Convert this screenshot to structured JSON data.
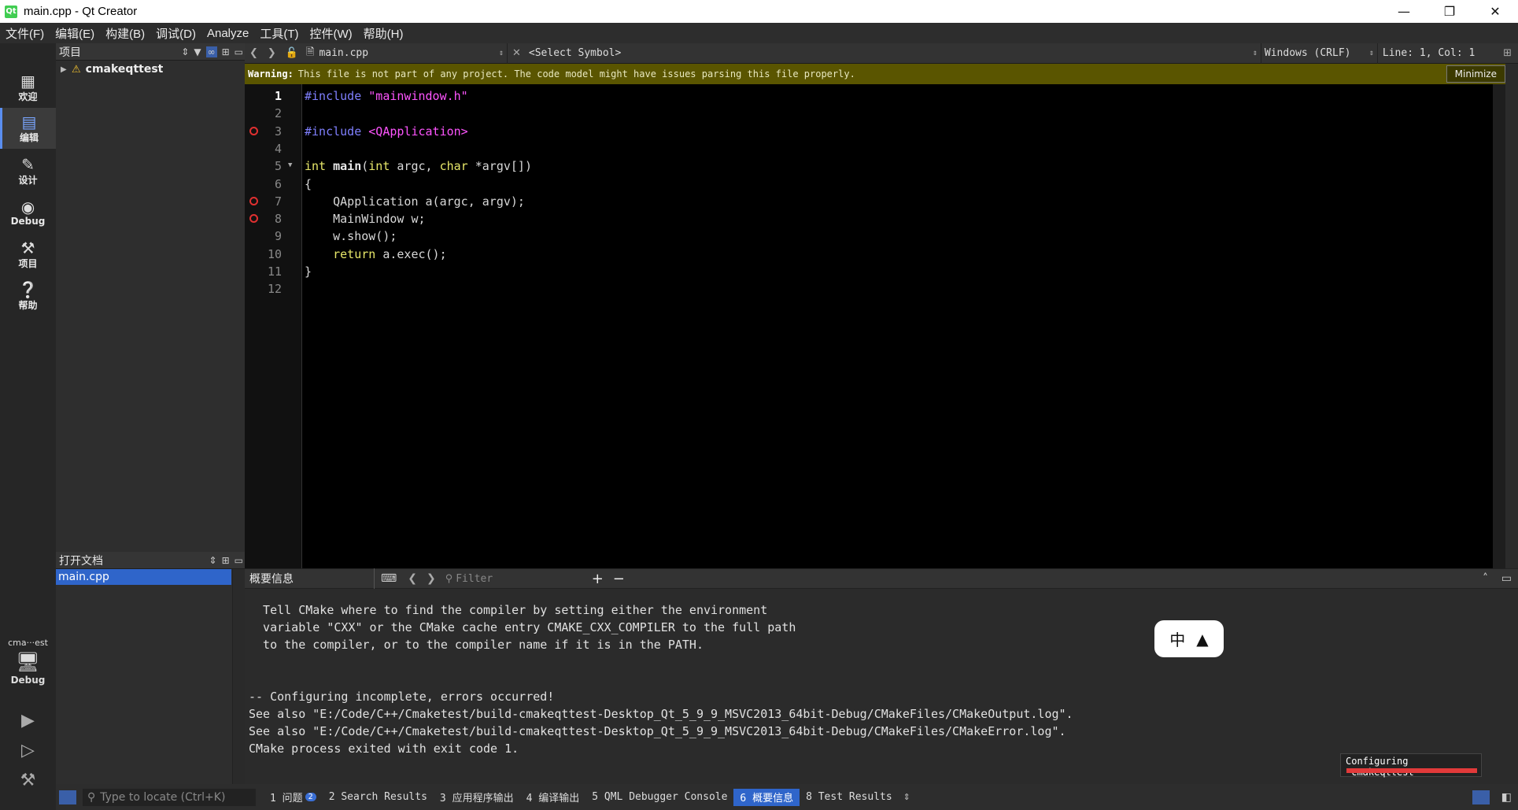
{
  "window": {
    "title": "main.cpp - Qt Creator",
    "app_icon": "Qt"
  },
  "menu": [
    "文件(F)",
    "编辑(E)",
    "构建(B)",
    "调试(D)",
    "Analyze",
    "工具(T)",
    "控件(W)",
    "帮助(H)"
  ],
  "modes": [
    {
      "label": "欢迎",
      "icon": "grid-icon"
    },
    {
      "label": "编辑",
      "icon": "edit-icon",
      "active": true
    },
    {
      "label": "设计",
      "icon": "pencil-icon"
    },
    {
      "label": "Debug",
      "icon": "bug-icon"
    },
    {
      "label": "项目",
      "icon": "wrench-icon"
    },
    {
      "label": "帮助",
      "icon": "help-icon"
    }
  ],
  "kit": {
    "project": "cma···est",
    "config": "Debug"
  },
  "projects_pane": {
    "title": "项目",
    "tree": [
      {
        "label": "cmakeqttest",
        "warning": true
      }
    ]
  },
  "open_docs": {
    "title": "打开文档",
    "files": [
      "main.cpp"
    ]
  },
  "editor_toolbar": {
    "file": "main.cpp",
    "symbol": "<Select Symbol>",
    "line_ending": "Windows (CRLF)",
    "position": "Line: 1, Col: 1"
  },
  "warning": {
    "label": "Warning:",
    "text": "This file is not part of any project. The code model might have issues parsing this file properly.",
    "button": "Minimize"
  },
  "code_lines": [
    {
      "n": "1",
      "html": "<span class=\"pp\">#include</span> <span class=\"str\">\"mainwindow.h\"</span>"
    },
    {
      "n": "2",
      "html": ""
    },
    {
      "n": "3",
      "html": "<span class=\"pp\">#include</span> <span class=\"str\">&lt;QApplication&gt;</span>",
      "bp": true
    },
    {
      "n": "4",
      "html": ""
    },
    {
      "n": "5",
      "html": "<span class=\"kw\">int</span> <span class=\"fn\">main</span>(<span class=\"kw\">int</span> argc, <span class=\"kw\">char</span> *argv[])",
      "fold": true
    },
    {
      "n": "6",
      "html": "{"
    },
    {
      "n": "7",
      "html": "    QApplication a(argc, argv);",
      "bp": true
    },
    {
      "n": "8",
      "html": "    MainWindow w;",
      "bp": true
    },
    {
      "n": "9",
      "html": "    w.show();"
    },
    {
      "n": "10",
      "html": "    <span class=\"kw\">return</span> a.exec();"
    },
    {
      "n": "11",
      "html": "}"
    },
    {
      "n": "12",
      "html": ""
    }
  ],
  "output_pane": {
    "title": "概要信息",
    "filter_placeholder": "Filter",
    "lines": [
      "  Tell CMake where to find the compiler by setting either the environment",
      "  variable \"CXX\" or the CMake cache entry CMAKE_CXX_COMPILER to the full path",
      "  to the compiler, or to the compiler name if it is in the PATH.",
      "",
      "",
      "-- Configuring incomplete, errors occurred!",
      "See also \"E:/Code/C++/Cmaketest/build-cmakeqttest-Desktop_Qt_5_9_9_MSVC2013_64bit-Debug/CMakeFiles/CMakeOutput.log\".",
      "See also \"E:/Code/C++/Cmaketest/build-cmakeqttest-Desktop_Qt_5_9_9_MSVC2013_64bit-Debug/CMakeFiles/CMakeError.log\".",
      "CMake process exited with exit code 1."
    ]
  },
  "ime": {
    "mode": "中",
    "icon": "shirt-icon"
  },
  "progress": {
    "label": "Configuring \"cmakeqttest\""
  },
  "status": {
    "locator_placeholder": "Type to locate (Ctrl+K)",
    "tabs": [
      {
        "label": "1 问题",
        "badge": "2"
      },
      {
        "label": "2 Search Results"
      },
      {
        "label": "3 应用程序输出"
      },
      {
        "label": "4 编译输出"
      },
      {
        "label": "5 QML Debugger Console"
      },
      {
        "label": "6 概要信息",
        "active": true
      },
      {
        "label": "8 Test Results"
      }
    ]
  }
}
